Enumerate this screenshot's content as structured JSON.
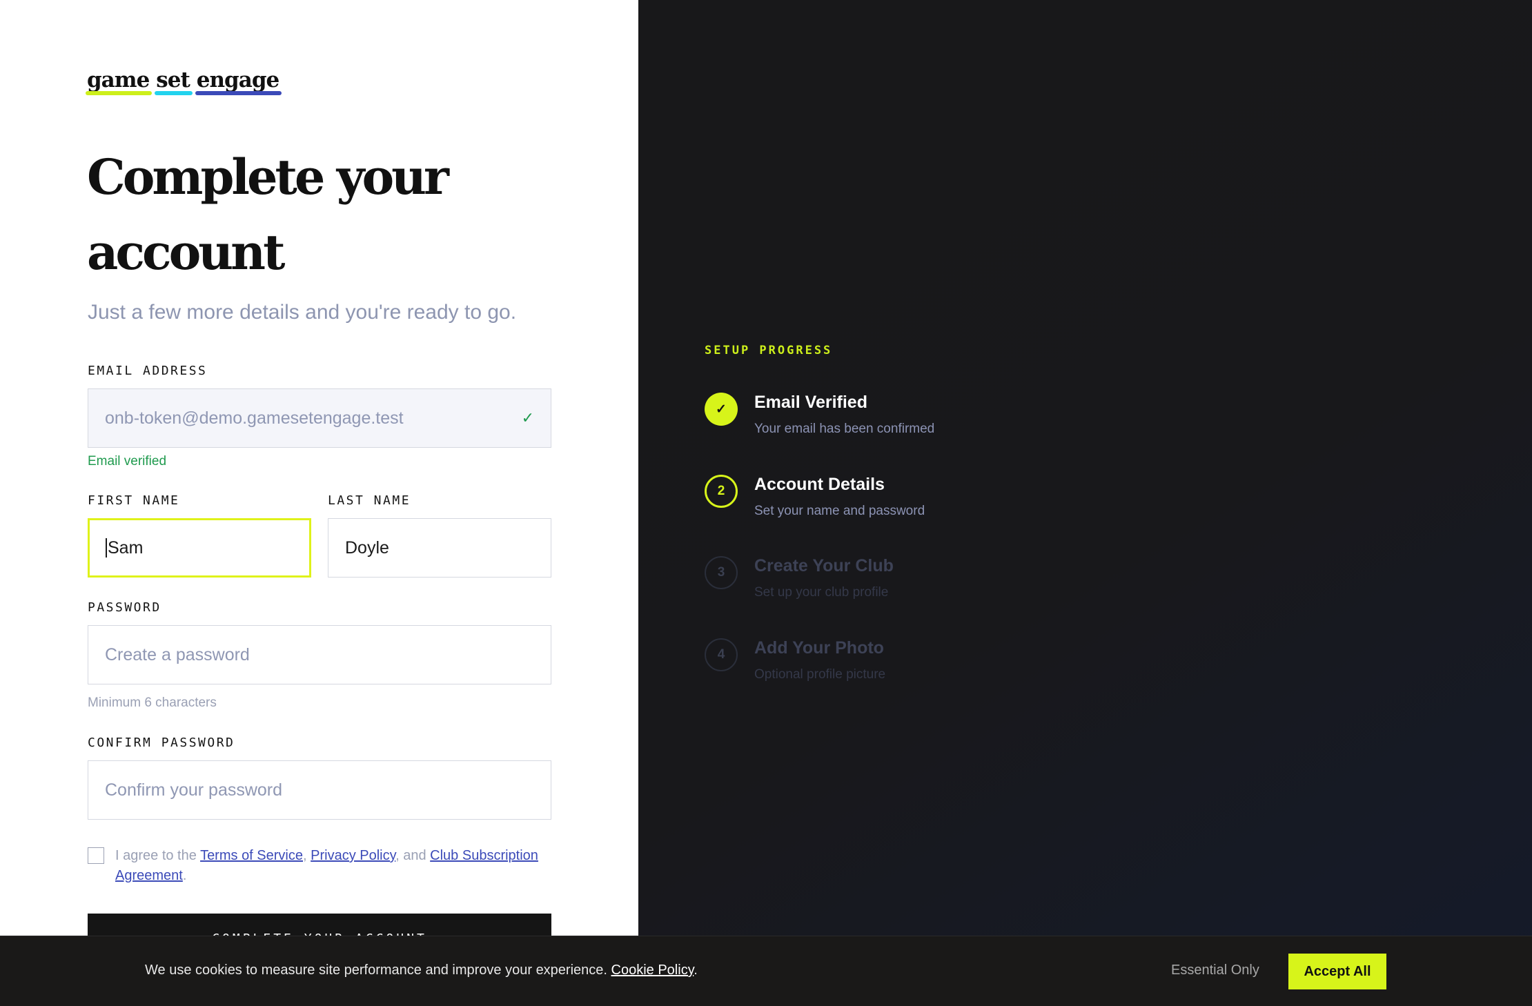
{
  "logo": {
    "words": [
      {
        "text": "game",
        "color": "#cdef1b"
      },
      {
        "text": "set",
        "color": "#22d3ee"
      },
      {
        "text": "engage",
        "color": "#3b4ab8"
      }
    ]
  },
  "page": {
    "title_line1": "Complete your",
    "title_line2": "account",
    "subtitle": "Just a few more details and you're ready to go."
  },
  "form": {
    "email_label": "EMAIL ADDRESS",
    "email_value": "onb-token@demo.gamesetengage.test",
    "email_status": "Email verified",
    "first_name_label": "FIRST NAME",
    "first_name_value": "Sam",
    "last_name_label": "LAST NAME",
    "last_name_value": "Doyle",
    "password_label": "PASSWORD",
    "password_placeholder": "Create a password",
    "password_hint": "Minimum 6 characters",
    "confirm_label": "CONFIRM PASSWORD",
    "confirm_placeholder": "Confirm your password",
    "agree_prefix": "I agree to the ",
    "terms_link": "Terms of Service",
    "comma1": ", ",
    "privacy_link": "Privacy Policy",
    "and_text": ", and ",
    "club_link": "Club Subscription Agreement",
    "period": ".",
    "submit_label": "COMPLETE YOUR ACCOUNT"
  },
  "progress": {
    "heading": "SETUP PROGRESS",
    "steps": [
      {
        "number": "✓",
        "title": "Email Verified",
        "desc": "Your email has been confirmed",
        "state": "done"
      },
      {
        "number": "2",
        "title": "Account Details",
        "desc": "Set your name and password",
        "state": "active"
      },
      {
        "number": "3",
        "title": "Create Your Club",
        "desc": "Set up your club profile",
        "state": "pending"
      },
      {
        "number": "4",
        "title": "Add Your Photo",
        "desc": "Optional profile picture",
        "state": "pending"
      }
    ]
  },
  "cookie": {
    "text": "We use cookies to measure site performance and improve your experience. ",
    "link": "Cookie Policy",
    "period": ".",
    "essential_label": "Essential Only",
    "accept_label": "Accept All"
  },
  "colors": {
    "accent": "#d7f41a",
    "success": "#1f9a4e",
    "link": "#3b4ab8"
  }
}
